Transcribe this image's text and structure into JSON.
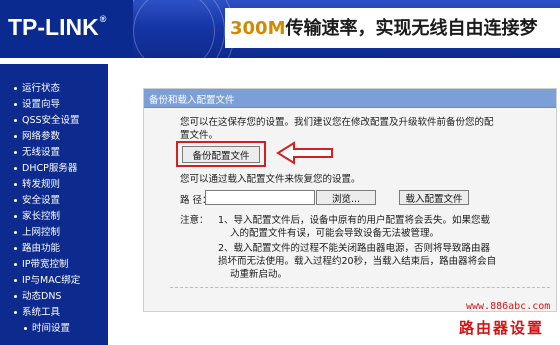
{
  "brand": {
    "logo": "TP-LINK",
    "reg": "®"
  },
  "banner": {
    "slogan_speed": "300M",
    "slogan_text": "传输速率，实现无线自由连接梦"
  },
  "sidebar": {
    "items": [
      {
        "label": "运行状态"
      },
      {
        "label": "设置向导"
      },
      {
        "label": "QSS安全设置"
      },
      {
        "label": "网络参数"
      },
      {
        "label": "无线设置"
      },
      {
        "label": "DHCP服务器"
      },
      {
        "label": "转发规则"
      },
      {
        "label": "安全设置"
      },
      {
        "label": "家长控制"
      },
      {
        "label": "上网控制"
      },
      {
        "label": "路由功能"
      },
      {
        "label": "IP带宽控制"
      },
      {
        "label": "IP与MAC绑定"
      },
      {
        "label": "动态DNS"
      },
      {
        "label": "系统工具"
      },
      {
        "label": "时间设置"
      }
    ]
  },
  "panel": {
    "title": "备份和载入配置文件",
    "intro_line1": "您可以在这保存您的设置。我们建议您在修改配置及升级软件前备份您的配",
    "intro_line2": "置文件。",
    "backup_button": "备份配置文件",
    "restore_text": "您可以通过载入配置文件来恢复您的设置。",
    "path_label": "路 径：",
    "browse_button": "浏览...",
    "load_button": "载入配置文件",
    "note_label": "注意：",
    "note1_line1": "1、导入配置文件后，设备中原有的用户配置将会丢失。如果您载",
    "note1_line2": "入的配置文件有误，可能会导致设备无法被管理。",
    "note2_line1": "2、载入配置文件的过程不能关闭路由器电源，否则将导致路由器",
    "note2_line2": "损坏而无法使用。载入过程约20秒，当载入结束后，路由器将会自",
    "note2_line3": "动重新启动。"
  },
  "watermark": {
    "url": "www.886abc.com",
    "name": "路由器设置"
  },
  "colors": {
    "banner": "#0a2a8f",
    "panel_header": "#7c9fd8",
    "highlight": "#d62020",
    "watermark": "#d41414"
  },
  "icons": {
    "annotation_arrow": "left-arrow-icon"
  }
}
